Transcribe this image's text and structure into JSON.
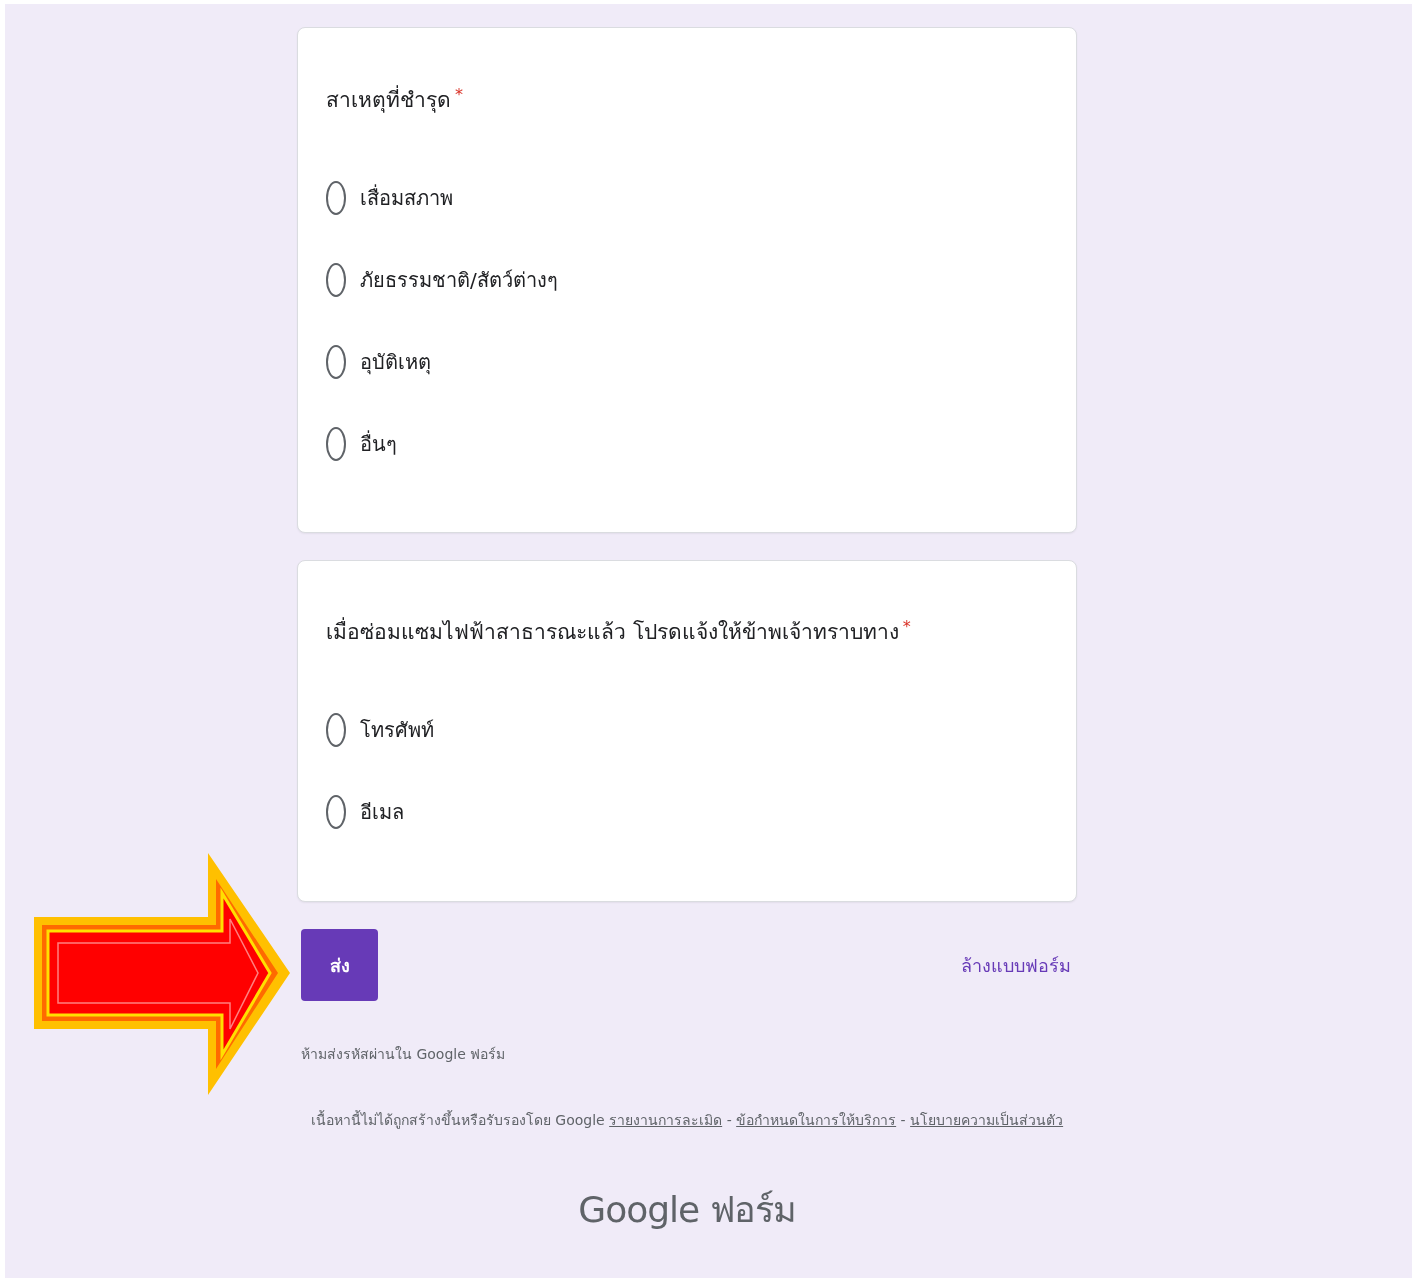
{
  "questions": [
    {
      "title": "สาเหตุที่ชำรุด",
      "required_mark": "*",
      "options": [
        {
          "label": "เสื่อมสภาพ",
          "checked": false
        },
        {
          "label": "ภัยธรรมชาติ/สัตว์ต่างๆ",
          "checked": false
        },
        {
          "label": "อุบัติเหตุ",
          "checked": false
        },
        {
          "label": "อื่นๆ",
          "checked": false
        }
      ]
    },
    {
      "title": "เมื่อซ่อมแซมไฟฟ้าสาธารณะแล้ว โปรดแจ้งให้ข้าพเจ้าทราบทาง",
      "required_mark": "*",
      "options": [
        {
          "label": "โทรศัพท์",
          "checked": false
        },
        {
          "label": "อีเมล",
          "checked": false
        }
      ]
    }
  ],
  "submit_button": "ส่ง",
  "clear_link": "ล้างแบบฟอร์ม",
  "password_notice": "ห้ามส่งรหัสผ่านใน Google ฟอร์ม",
  "footer_notice": [
    {
      "kind": "text",
      "text": "เนื้อหานี้ไม่ได้ถูกสร้างขึ้นหรือรับรองโดย Google"
    },
    {
      "kind": "link",
      "text": "รายงานการละเมิด"
    },
    {
      "kind": "text",
      "text": "-"
    },
    {
      "kind": "link",
      "text": "ข้อกำหนดในการให้บริการ"
    },
    {
      "kind": "text",
      "text": "-"
    },
    {
      "kind": "link",
      "text": "นโยบายความเป็นส่วนตัว"
    }
  ],
  "logo": {
    "brand": "Google",
    "product": "ฟอร์ม"
  },
  "annotation": {
    "kind": "arrow"
  }
}
